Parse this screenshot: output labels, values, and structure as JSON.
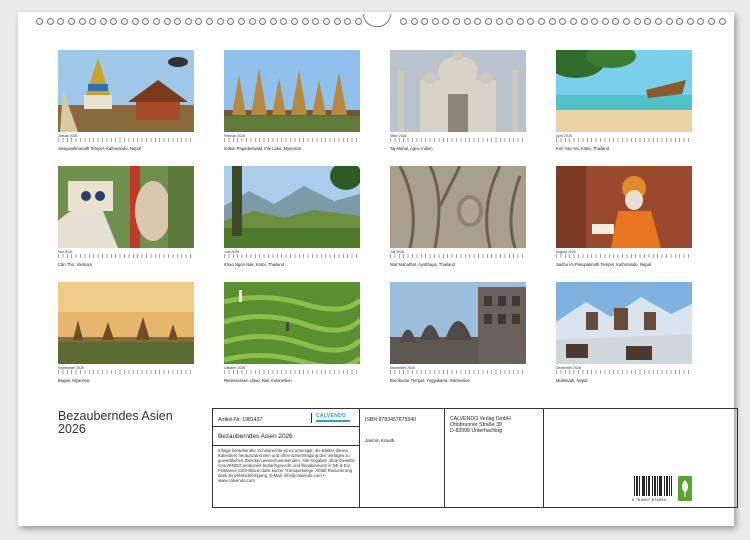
{
  "calendar": {
    "title_line1": "Bezauberndes Asien",
    "title_line2": "2026",
    "months": [
      {
        "month": "Januar 2026",
        "caption": "Swayambhunath Tempel, Kathmandu, Nepal",
        "scene": "stupa"
      },
      {
        "month": "Februar 2026",
        "caption": "Indein Pagodenwald, Inle Lake, Myanmar",
        "scene": "pagodas"
      },
      {
        "month": "März 2026",
        "caption": "Taj Mahal, Agra, Indien",
        "scene": "taj"
      },
      {
        "month": "April 2026",
        "caption": "Koh Yao Yai, Krabi, Thailand",
        "scene": "beach"
      },
      {
        "month": "Mai 2026",
        "caption": "Cần Thơ, Vietnam",
        "scene": "monk"
      },
      {
        "month": "Juni 2026",
        "caption": "Khao Ngon Nak, Krabi, Thailand",
        "scene": "valley"
      },
      {
        "month": "Juli 2026",
        "caption": "Wat Mahathat, Ayutthaya, Thailand",
        "scene": "roots"
      },
      {
        "month": "August 2026",
        "caption": "Sadhu im Pasupatinath Tempel, Kathmandu, Nepal",
        "scene": "sadhu"
      },
      {
        "month": "September 2026",
        "caption": "Bagan, Myanmar",
        "scene": "bagan"
      },
      {
        "month": "Oktober 2026",
        "caption": "Reisterassen Ubud, Bali, Indonesien",
        "scene": "rice"
      },
      {
        "month": "November 2026",
        "caption": "Borobudur Tempel, Yogyakarta, Indonesien",
        "scene": "borobudur"
      },
      {
        "month": "Dezember 2026",
        "caption": "Muktinath, Nepal",
        "scene": "mountains"
      }
    ]
  },
  "info": {
    "article_label": "Artikel-Nr. 1981437",
    "product_name": "Bezauberndes Asien 2026",
    "legal_text": "Infolge bestehender Schutzrechte ist es untersagt, die Blätter dieses Kalenders herauszutrennen und ohne Genehmigung des Verlages zu gewerblichen Zwecken weiterzuverwenden. Alle Angaben ohne Gewähr. CALVENDO produziert bedarfsgerecht und klimabewusst in DE & EU. Positivere CO2-Bilanz dank kurzer Transportwege. Abfall-Reduzierung dank Einzelstückfertigung. E-Mail: info@calvendo.com • www.calvendo.com",
    "isbn": "ISBN 9783457675540",
    "author": "Jasmin Krauth",
    "publisher_line1": "CALVENDO Verlag GmbH",
    "publisher_line2": "Ottobrunner Straße 39",
    "publisher_line3": "D-82008 Unterhaching",
    "barcode_number": "9 783457 675540",
    "logo_text": "CALVENDO"
  }
}
